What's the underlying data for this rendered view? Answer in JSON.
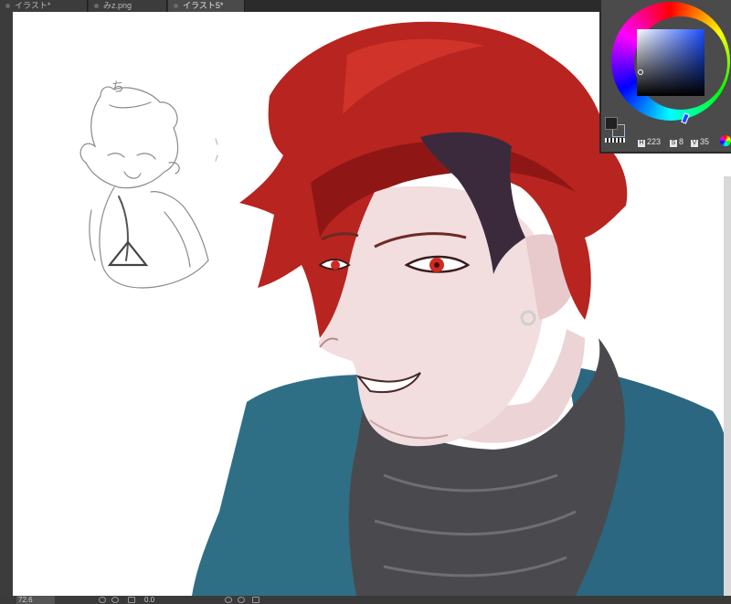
{
  "tabs": [
    {
      "label": "イラスト*",
      "active": false
    },
    {
      "label": "みz.png",
      "active": false
    },
    {
      "label": "イラスト5*",
      "active": true
    }
  ],
  "color_panel": {
    "hue_label": "H",
    "hue_value": "223",
    "saturation_label": "S",
    "saturation_value": "8",
    "value_label": "V",
    "value_value": "35",
    "main_color": "#212121"
  },
  "status_bar": {
    "zoom": "72.6",
    "rotation": "0.0"
  },
  "canvas": {
    "sketch_caption": "ち",
    "palette": {
      "hair": "#b8241f",
      "skin": "#f2dddf",
      "jacket": "#2f6f86",
      "scarf": "#4a4a4e",
      "eye": "#cc2a23"
    }
  }
}
